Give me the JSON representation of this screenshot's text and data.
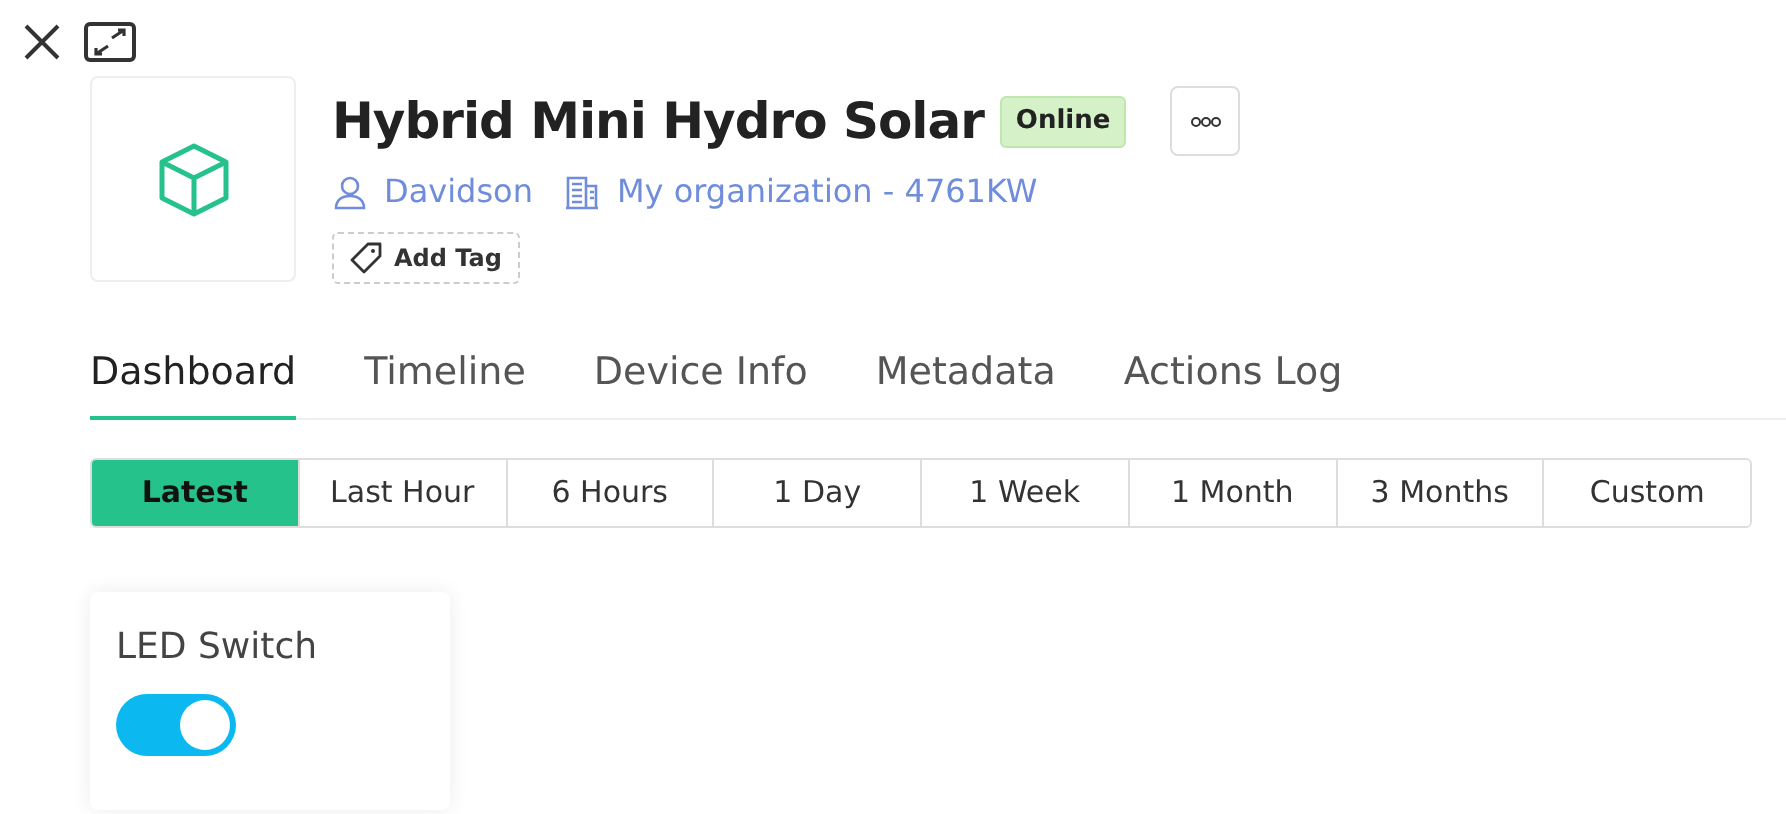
{
  "device": {
    "name": "Hybrid Mini Hydro Solar",
    "status": "Online",
    "owner": "Davidson",
    "organization": "My organization - 4761KW",
    "add_tag": "Add Tag"
  },
  "tabs": [
    {
      "label": "Dashboard",
      "selected": true
    },
    {
      "label": "Timeline",
      "selected": false
    },
    {
      "label": "Device Info",
      "selected": false
    },
    {
      "label": "Metadata",
      "selected": false
    },
    {
      "label": "Actions Log",
      "selected": false
    }
  ],
  "ranges": [
    {
      "label": "Latest",
      "selected": true
    },
    {
      "label": "Last Hour",
      "selected": false
    },
    {
      "label": "6 Hours",
      "selected": false
    },
    {
      "label": "1 Day",
      "selected": false
    },
    {
      "label": "1 Week",
      "selected": false
    },
    {
      "label": "1 Month",
      "selected": false
    },
    {
      "label": "3 Months",
      "selected": false
    },
    {
      "label": "Custom",
      "selected": false
    }
  ],
  "widgets": [
    {
      "title": "LED Switch",
      "on": true
    }
  ]
}
